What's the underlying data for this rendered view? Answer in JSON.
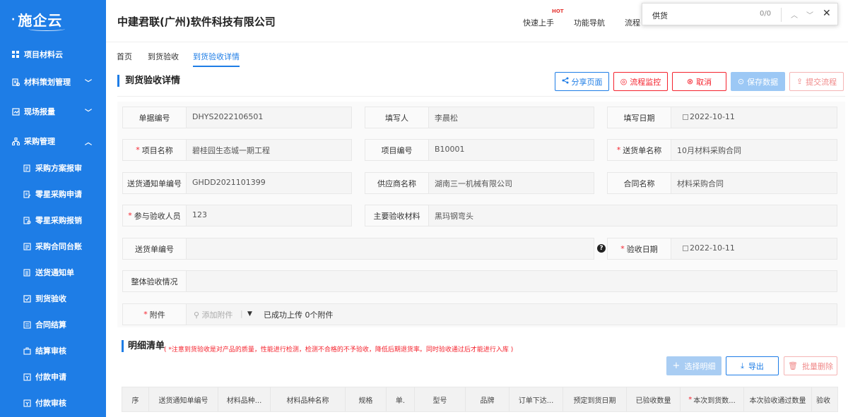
{
  "sidebar": {
    "logo_text": "施企云",
    "items": [
      {
        "label": "项目材料云",
        "icon": "grid-icon"
      },
      {
        "label": "材料策划管理",
        "icon": "plan-icon"
      },
      {
        "label": "现场报量",
        "icon": "report-icon"
      },
      {
        "label": "采购管理",
        "icon": "org-icon"
      },
      {
        "label": "采购方案报审",
        "icon": "doc-icon"
      },
      {
        "label": "零星采购申请",
        "icon": "apply-icon"
      },
      {
        "label": "零星采购报销",
        "icon": "reimburse-icon"
      },
      {
        "label": "采购合同台账",
        "icon": "ledger-icon"
      },
      {
        "label": "送货通知单",
        "icon": "list-icon"
      },
      {
        "label": "到货验收",
        "icon": "check-icon"
      },
      {
        "label": "合同结算",
        "icon": "settle-icon"
      },
      {
        "label": "结算审核",
        "icon": "audit-icon"
      },
      {
        "label": "付款申请",
        "icon": "pay-icon"
      },
      {
        "label": "付款审核",
        "icon": "pay-audit-icon"
      }
    ]
  },
  "header": {
    "company": "中建君联(广州)软件科技有限公司",
    "links": [
      "快速上手",
      "功能导航",
      "流程"
    ],
    "hot_badge": "HOT"
  },
  "find_bar": {
    "query": "供货",
    "count": "0/0"
  },
  "tabs": [
    "首页",
    "到货验收",
    "到货验收详情"
  ],
  "page": {
    "title": "到货验收详情",
    "buttons": {
      "share": "分享页面",
      "monitor": "流程监控",
      "cancel": "取消",
      "save": "保存数据",
      "submit": "提交流程"
    }
  },
  "form": {
    "doc_no_label": "单据编号",
    "doc_no": "DHYS2022106501",
    "filler_label": "填写人",
    "filler": "李晨松",
    "fill_date_label": "填写日期",
    "fill_date": "2022-10-11",
    "project_name_label": "项目名称",
    "project_name": "碧桂园生态城一期工程",
    "project_no_label": "项目编号",
    "project_no": "B10001",
    "delivery_name_label": "送货单名称",
    "delivery_name": "10月材料采购合同",
    "notice_no_label": "送货通知单编号",
    "notice_no": "GHDD2021101399",
    "supplier_label": "供应商名称",
    "supplier": "湖南三一机械有限公司",
    "contract_label": "合同名称",
    "contract": "材料采购合同",
    "inspectors_label": "参与验收人员",
    "inspectors": "123",
    "materials_label": "主要验收材料",
    "materials": "黑玛钢弯头",
    "delivery_no_label": "送货单编号",
    "delivery_no": "",
    "accept_date_label": "验收日期",
    "accept_date": "2022-10-11",
    "overall_label": "整体验收情况",
    "overall": "",
    "attach_label": "附件",
    "attach_add": "添加附件",
    "attach_status": "已成功上传 0个附件"
  },
  "detail": {
    "title": "明细清单",
    "note": "( *注意到货验收是对产品的质量，性能进行检测，检测不合格的不予验收，降低后期退货率。同时验收通过后才能进行入库 )",
    "select_btn": "选择明细",
    "export_btn": "导出",
    "batch_delete_btn": "批量删除",
    "columns": [
      "序",
      "送货通知单编号",
      "材料品种...",
      "材料品种名称",
      "规格",
      "单.",
      "型号",
      "品牌",
      "订单下达...",
      "预定到货日期",
      "已验收数量",
      "本次到货数...",
      "本次验收通过数量",
      "验收"
    ]
  }
}
